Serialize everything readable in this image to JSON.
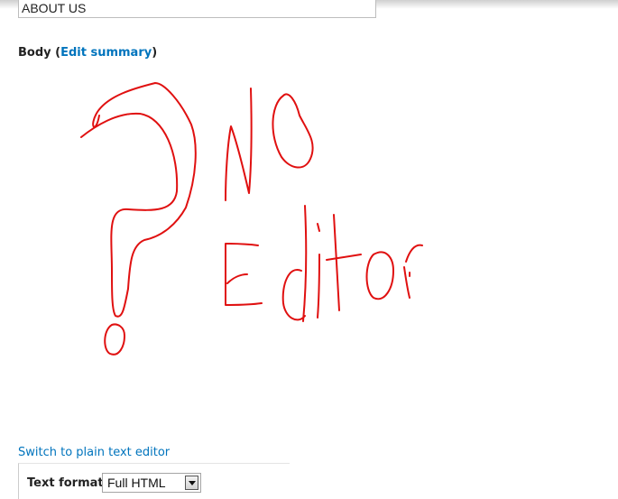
{
  "title_field": {
    "value": "ABOUT US"
  },
  "body_field": {
    "label": "Body",
    "open_paren": " (",
    "edit_summary_link": "Edit summary",
    "close_paren": ")"
  },
  "sketch": {
    "handwritten_text": "? NO editor",
    "stroke_color": "#e01010"
  },
  "switch_editor_link": "Switch to plain text editor",
  "text_format": {
    "label": "Text format",
    "selected": "Full HTML",
    "dropdown_icon": "chevron-down-icon"
  },
  "colors": {
    "link": "#0074bd",
    "sketch": "#e01010"
  }
}
